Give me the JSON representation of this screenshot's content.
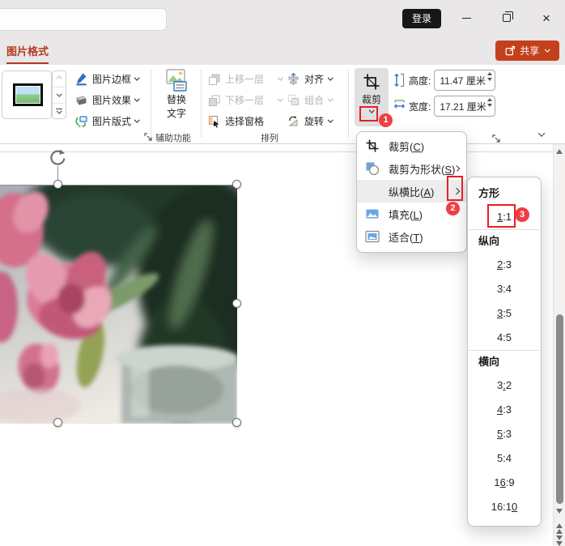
{
  "titlebar": {
    "login": "登录"
  },
  "tabs": {
    "picture_format": "图片格式",
    "share": "共享"
  },
  "ribbon": {
    "border_buttons": [
      {
        "label": "图片边框"
      },
      {
        "label": "图片效果"
      },
      {
        "label": "图片版式"
      }
    ],
    "alt_text": {
      "line1": "替换",
      "line2": "文字",
      "group_label": "辅助功能"
    },
    "arrange": {
      "col1": [
        {
          "label": "上移一层",
          "disabled": true
        },
        {
          "label": "下移一层",
          "disabled": true
        },
        {
          "label": "选择窗格",
          "disabled": false
        }
      ],
      "col2": [
        {
          "label": "对齐",
          "disabled": false
        },
        {
          "label": "组合",
          "disabled": true
        },
        {
          "label": "旋转",
          "disabled": false
        }
      ],
      "group_label": "排列"
    },
    "size": {
      "crop_label": "裁剪",
      "height_label": "高度:",
      "height_value": "11.47 厘米",
      "width_label": "宽度:",
      "width_value": "17.21 厘米"
    }
  },
  "menu": {
    "items": [
      {
        "pre": "裁剪(",
        "key": "C",
        "post": ")"
      },
      {
        "pre": "裁剪为形状(",
        "key": "S",
        "post": ")"
      },
      {
        "pre": "纵横比(",
        "key": "A",
        "post": ")"
      },
      {
        "pre": "填充(",
        "key": "L",
        "post": ")"
      },
      {
        "pre": "适合(",
        "key": "T",
        "post": ")"
      }
    ]
  },
  "submenu": {
    "square_header": "方形",
    "square_1_1": {
      "pre": "",
      "key": "1",
      "post": ":1"
    },
    "portrait_header": "纵向",
    "portrait": [
      {
        "pre": "",
        "key": "2",
        "post": ":3"
      },
      {
        "pre": "3:4",
        "key": "",
        "post": ""
      },
      {
        "pre": "",
        "key": "3",
        "post": ":5"
      },
      {
        "pre": "4:5",
        "key": "",
        "post": ""
      }
    ],
    "landscape_header": "横向",
    "landscape": [
      {
        "pre": "3",
        "key": ":",
        "post": "2"
      },
      {
        "pre": "",
        "key": "4",
        "post": ":3"
      },
      {
        "pre": "",
        "key": "5",
        "post": ":3"
      },
      {
        "pre": "5:4",
        "key": "",
        "post": ""
      },
      {
        "pre": "1",
        "key": "6",
        "post": ":9"
      },
      {
        "pre": "16:1",
        "key": "0",
        "post": ""
      }
    ]
  },
  "annotations": {
    "step1": "1",
    "step2": "2",
    "step3": "3"
  },
  "colors": {
    "accent_share": "#c4401c",
    "tab_red": "#b43a1e",
    "annotation_red": "#ec1c24",
    "badge_red": "#ee3f44"
  },
  "icons": {
    "minimize": "─",
    "restore": "⧉",
    "close": "×",
    "share": "box-arrow-up",
    "chevron_down": "v",
    "submenu_arrow": "›",
    "crop": "crop-marks",
    "scroll_up": "▲",
    "scroll_down": "▼",
    "previous_slide": "▲▲",
    "next_slide": "▼▼",
    "rotate_handle": "circular-arrow",
    "dialog_launcher": "corner-arrow"
  }
}
